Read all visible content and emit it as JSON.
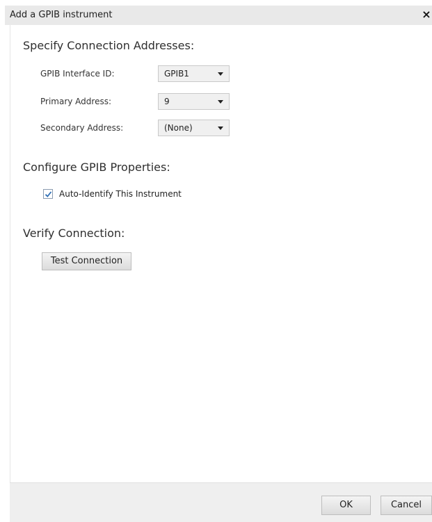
{
  "dialog": {
    "title": "Add a GPIB instrument",
    "close_label": "×"
  },
  "connection": {
    "heading": "Specify Connection Addresses:",
    "interface_label": "GPIB Interface ID:",
    "interface_value": "GPIB1",
    "primary_label": "Primary Address:",
    "primary_value": "9",
    "secondary_label": "Secondary Address:",
    "secondary_value": "(None)"
  },
  "properties": {
    "heading": "Configure GPIB Properties:",
    "auto_identify_label": "Auto-Identify This Instrument",
    "auto_identify_checked": true
  },
  "verify": {
    "heading": "Verify Connection:",
    "test_button_label": "Test Connection"
  },
  "footer": {
    "ok_label": "OK",
    "cancel_label": "Cancel"
  },
  "colors": {
    "titlebar_bg": "#e9e9e9",
    "check_color": "#2f6fb5"
  }
}
